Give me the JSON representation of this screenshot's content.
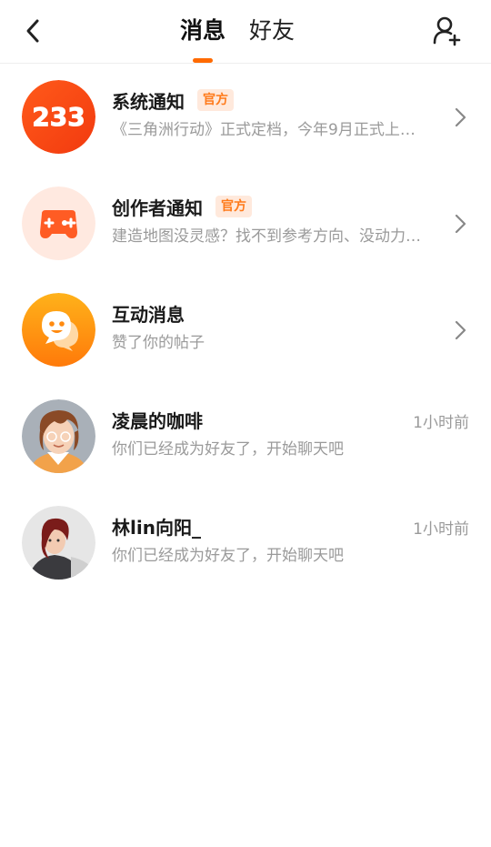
{
  "header": {
    "tabs": [
      {
        "label": "消息",
        "active": true
      },
      {
        "label": "好友",
        "active": false
      }
    ],
    "accent_color": "#ff6a00"
  },
  "messages": [
    {
      "title": "系统通知",
      "badge": "官方",
      "subtitle": "《三角洲行动》正式定档，今年9月正式上…",
      "avatar_text": "233",
      "avatar_icon": "233-logo-icon"
    },
    {
      "title": "创作者通知",
      "badge": "官方",
      "subtitle": "建造地图没灵感？找不到参考方向、没动力…",
      "avatar_icon": "gamepad-icon"
    },
    {
      "title": "互动消息",
      "subtitle": "赞了你的帖子",
      "avatar_icon": "chat-bubble-icon"
    },
    {
      "title": "凌晨的咖啡",
      "time": "1小时前",
      "subtitle": "你们已经成为好友了，开始聊天吧",
      "avatar_icon": "user-avatar"
    },
    {
      "title": "林lin向阳_",
      "time": "1小时前",
      "subtitle": "你们已经成为好友了，开始聊天吧",
      "avatar_icon": "user-avatar"
    }
  ]
}
